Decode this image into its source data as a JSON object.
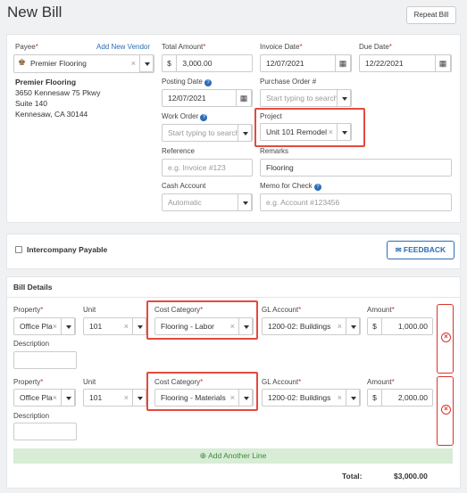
{
  "page": {
    "title": "New Bill",
    "repeat_label": "Repeat Bill"
  },
  "payee": {
    "label": "Payee",
    "add_vendor": "Add New Vendor",
    "value": "Premier Flooring",
    "address_name": "Premier Flooring",
    "address_line1": "3650 Kennesaw 75 Pkwy",
    "address_line2": "Suite 140",
    "address_line3": "Kennesaw, CA 30144"
  },
  "total_amount": {
    "label": "Total Amount",
    "currency": "$",
    "value": "3,000.00"
  },
  "invoice_date": {
    "label": "Invoice Date",
    "value": "12/07/2021"
  },
  "due_date": {
    "label": "Due Date",
    "value": "12/22/2021"
  },
  "posting_date": {
    "label": "Posting Date",
    "value": "12/07/2021"
  },
  "purchase_order": {
    "label": "Purchase Order #",
    "placeholder": "Start typing to search"
  },
  "work_order": {
    "label": "Work Order",
    "placeholder": "Start typing to search"
  },
  "project": {
    "label": "Project",
    "value": "Unit 101 Remodel"
  },
  "reference": {
    "label": "Reference",
    "placeholder": "e.g. Invoice #123"
  },
  "remarks": {
    "label": "Remarks",
    "value": "Flooring"
  },
  "cash_account": {
    "label": "Cash Account",
    "value": "Automatic"
  },
  "memo": {
    "label": "Memo for Check",
    "placeholder": "e.g. Account #123456"
  },
  "intercompany": {
    "label": "Intercompany Payable"
  },
  "feedback": {
    "label": "FEEDBACK"
  },
  "bill_details": {
    "title": "Bill Details",
    "headers": {
      "property": "Property",
      "unit": "Unit",
      "cost_category": "Cost Category",
      "gl_account": "GL Account",
      "amount": "Amount",
      "description": "Description"
    },
    "lines": [
      {
        "property": "Office Pla",
        "unit": "101",
        "cost_category": "Flooring - Labor",
        "gl_account": "1200-02: Buildings",
        "currency": "$",
        "amount": "1,000.00"
      },
      {
        "property": "Office Pla",
        "unit": "101",
        "cost_category": "Flooring - Materials",
        "gl_account": "1200-02: Buildings",
        "currency": "$",
        "amount": "2,000.00"
      }
    ],
    "add_line": "Add Another Line",
    "total_label": "Total:",
    "total_value": "$3,000.00"
  },
  "colors": {
    "accent": "#2a6db6",
    "danger": "#d9342b",
    "highlight": "#e34a3e",
    "success": "#3a8a3a"
  }
}
